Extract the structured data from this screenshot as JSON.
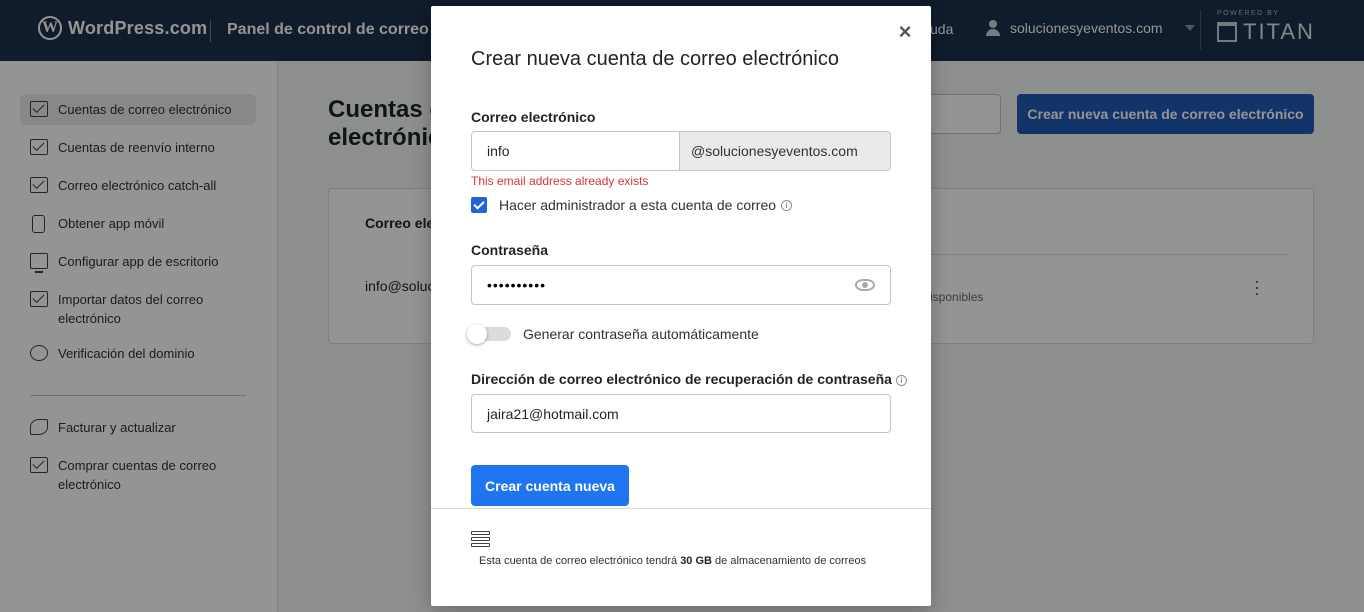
{
  "topbar": {
    "brand": "WordPress.com",
    "panel_title": "Panel de control de correo e",
    "help": "uda",
    "account": "solucionesyeventos.com",
    "powered_by": "POWERED BY",
    "titan": "TITAN"
  },
  "sidebar": {
    "items": [
      {
        "label": "Cuentas de correo electrónico",
        "icon": "mail-icon"
      },
      {
        "label": "Cuentas de reenvío interno",
        "icon": "forward-mail-icon"
      },
      {
        "label": "Correo electrónico catch-all",
        "icon": "catch-all-icon"
      },
      {
        "label": "Obtener app móvil",
        "icon": "phone-icon"
      },
      {
        "label": "Configurar app de escritorio",
        "icon": "monitor-icon"
      },
      {
        "label": "Importar datos del correo electrónico",
        "icon": "import-icon"
      },
      {
        "label": "Verificación del dominio",
        "icon": "globe-icon"
      },
      {
        "label": "Facturar y actualizar",
        "icon": "rocket-icon"
      },
      {
        "label": "Comprar cuentas de correo electrónico",
        "icon": "add-mail-icon"
      }
    ]
  },
  "main": {
    "title_line1": "Cuentas c",
    "title_line2": "electrónic",
    "create_button": "Crear nueva cuenta de correo electrónico",
    "table_header_email": "Correo ele",
    "row_email": "info@soluc",
    "row_available": "isponibles"
  },
  "modal": {
    "title": "Crear nueva cuenta de correo electrónico",
    "close": "×",
    "email_label": "Correo electrónico",
    "email_value": "info",
    "email_domain": "@solucionesyeventos.com",
    "error": "This email address already exists",
    "admin_label": "Hacer administrador a esta cuenta de correo",
    "admin_checked": true,
    "password_label": "Contraseña",
    "password_value": "••••••••••",
    "auto_password_label": "Generar contraseña automáticamente",
    "recovery_label": "Dirección de correo electrónico de recuperación de contraseña",
    "recovery_value": "jaira21@hotmail.com",
    "submit": "Crear cuenta nueva",
    "footer_pre": "Esta cuenta de correo electrónico tendrá",
    "footer_storage": "30 GB",
    "footer_post": "de almacenamiento de correos",
    "info_glyph": "i"
  },
  "colors": {
    "topbar": "#1d2f4b",
    "primary": "#1f74f0",
    "error": "#d63638"
  }
}
